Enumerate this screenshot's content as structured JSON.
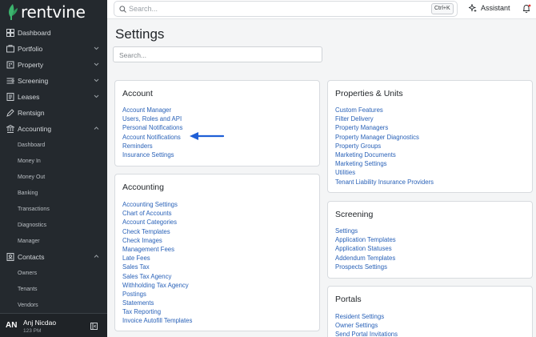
{
  "app": {
    "logo_text": "rentvine",
    "brand_color": "#3cb46e",
    "link_color": "#2a62b8"
  },
  "sidebar": {
    "items": [
      {
        "label": "Dashboard",
        "icon": "dashboard-icon"
      },
      {
        "label": "Portfolio",
        "icon": "portfolio-icon",
        "expandable": true
      },
      {
        "label": "Property",
        "icon": "property-icon",
        "expandable": true
      },
      {
        "label": "Screening",
        "icon": "screening-icon",
        "expandable": true
      },
      {
        "label": "Leases",
        "icon": "leases-icon",
        "expandable": true
      },
      {
        "label": "Rentsign",
        "icon": "rentsign-icon"
      },
      {
        "label": "Accounting",
        "icon": "accounting-icon",
        "expanded": true
      }
    ],
    "accounting_sub": [
      "Dashboard",
      "Money In",
      "Money Out",
      "Banking",
      "Transactions",
      "Diagnostics",
      "Manager"
    ],
    "contacts": {
      "label": "Contacts",
      "icon": "contacts-icon",
      "expanded": true
    },
    "contacts_sub": [
      "Owners",
      "Tenants",
      "Vendors"
    ],
    "user": {
      "initials": "AN",
      "name": "Anj Nicdao",
      "sub": "123 PM"
    }
  },
  "topbar": {
    "search_placeholder": "Search...",
    "shortcut": "Ctrl+K",
    "assistant_label": "Assistant"
  },
  "main": {
    "title": "Settings",
    "search_placeholder": "Search...",
    "cards": {
      "account": {
        "title": "Account",
        "links": [
          "Account Manager",
          "Users, Roles and API",
          "Personal Notifications",
          "Account Notifications",
          "Reminders",
          "Insurance Settings"
        ]
      },
      "accounting": {
        "title": "Accounting",
        "links": [
          "Accounting Settings",
          "Chart of Accounts",
          "Account Categories",
          "Check Templates",
          "Check Images",
          "Management Fees",
          "Late Fees",
          "Sales Tax",
          "Sales Tax Agency",
          "Withholding Tax Agency",
          "Postings",
          "Statements",
          "Tax Reporting",
          "Invoice Autofill Templates"
        ]
      },
      "properties": {
        "title": "Properties & Units",
        "links": [
          "Custom Features",
          "Filter Delivery",
          "Property Managers",
          "Property Manager Diagnostics",
          "Property Groups",
          "Marketing Documents",
          "Marketing Settings",
          "Utilities",
          "Tenant Liability Insurance Providers"
        ]
      },
      "screening": {
        "title": "Screening",
        "links": [
          "Settings",
          "Application Templates",
          "Application Statuses",
          "Addendum Templates",
          "Prospects Settings"
        ]
      },
      "portals": {
        "title": "Portals",
        "links": [
          "Resident Settings",
          "Owner Settings",
          "Send Portal Invitations"
        ]
      }
    },
    "annotation": {
      "type": "arrow",
      "color": "#1f5fd6",
      "points_to": "Account Notifications"
    }
  }
}
